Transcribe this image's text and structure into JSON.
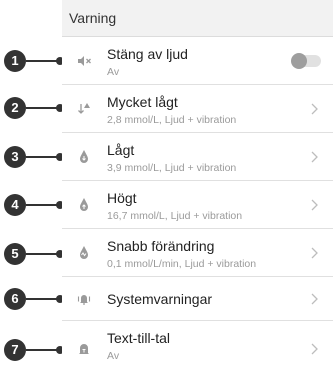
{
  "section": {
    "title": "Varning"
  },
  "rows": [
    {
      "title": "Stäng av ljud",
      "subtitle": "Av",
      "icon": "mute-icon",
      "control": "toggle",
      "toggle_on": false
    },
    {
      "title": "Mycket lågt",
      "subtitle": "2,8 mmol/L, Ljud + vibration",
      "icon": "very-low-icon",
      "control": "chevron"
    },
    {
      "title": "Lågt",
      "subtitle": "3,9 mmol/L, Ljud + vibration",
      "icon": "low-icon",
      "control": "chevron"
    },
    {
      "title": "Högt",
      "subtitle": "16,7 mmol/L, Ljud + vibration",
      "icon": "high-icon",
      "control": "chevron"
    },
    {
      "title": "Snabb förändring",
      "subtitle": "0,1 mmol/L/min, Ljud + vibration",
      "icon": "rate-change-icon",
      "control": "chevron"
    },
    {
      "title": "Systemvarningar",
      "subtitle": "",
      "icon": "system-alert-icon",
      "control": "chevron"
    },
    {
      "title": "Text-till-tal",
      "subtitle": "Av",
      "icon": "text-to-speech-icon",
      "control": "chevron"
    }
  ],
  "callouts": [
    "1",
    "2",
    "3",
    "4",
    "5",
    "6",
    "7"
  ],
  "colors": {
    "icon_grey": "#9a9a9a",
    "callout": "#333333",
    "background": "#f2f2f2"
  }
}
